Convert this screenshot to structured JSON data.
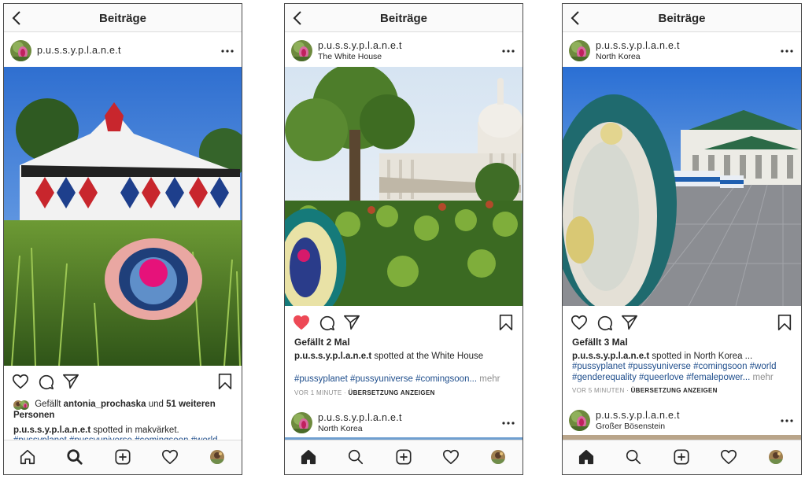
{
  "screens": [
    {
      "header_title": "Beiträge",
      "post": {
        "username": "p.u.s.s.y.p.l.a.n.e.t",
        "location": "",
        "liked": false,
        "liked_by_prefix": "Gefällt",
        "liked_by_user": "antonia_prochaska",
        "liked_by_middle": "und",
        "liked_by_count": "51 weiteren",
        "liked_by_suffix": "Personen",
        "caption_user": "p.u.s.s.y.p.l.a.n.e.t",
        "caption_text": "spotted in makvärket.",
        "hashtags": "#pussyplanet #pussyuniverse #comingsoon #world"
      },
      "nav_active": "search"
    },
    {
      "header_title": "Beiträge",
      "post": {
        "username": "p.u.s.s.y.p.l.a.n.e.t",
        "location": "The White House",
        "liked": true,
        "likes_text": "Gefällt 2 Mal",
        "caption_user": "p.u.s.s.y.p.l.a.n.e.t",
        "caption_text": "spotted at the White House",
        "hashtags": "#pussyplanet #pussyuniverse #comingsoon...",
        "more_label": "mehr",
        "time_ago": "VOR 1 MINUTE",
        "translate_label": "ÜBERSETZUNG ANZEIGEN"
      },
      "next_post": {
        "username": "p.u.s.s.y.p.l.a.n.e.t",
        "location": "North Korea"
      },
      "nav_active": "home"
    },
    {
      "header_title": "Beiträge",
      "post": {
        "username": "p.u.s.s.y.p.l.a.n.e.t",
        "location": "North Korea",
        "liked": false,
        "likes_text": "Gefällt 3 Mal",
        "caption_user": "p.u.s.s.y.p.l.a.n.e.t",
        "caption_text": "spotted in North Korea ...",
        "hashtags": "#pussyplanet #pussyuniverse #comingsoon #world #genderequality #queerlove #femalepower...",
        "more_label": "mehr",
        "time_ago": "VOR 5 MINUTEN",
        "translate_label": "ÜBERSETZUNG ANZEIGEN"
      },
      "next_post": {
        "username": "p.u.s.s.y.p.l.a.n.e.t",
        "location": "Großer Bösenstein"
      },
      "nav_active": "home"
    }
  ],
  "icons": [
    "back-icon",
    "more-icon",
    "heart-icon",
    "comment-icon",
    "share-icon",
    "bookmark-icon",
    "home-icon",
    "search-icon",
    "add-icon",
    "activity-icon"
  ],
  "colors": {
    "like_red": "#ed4956",
    "hashtag_blue": "#1f4e8c",
    "muted_gray": "#8e8e8e",
    "border": "#dbdbdb"
  }
}
